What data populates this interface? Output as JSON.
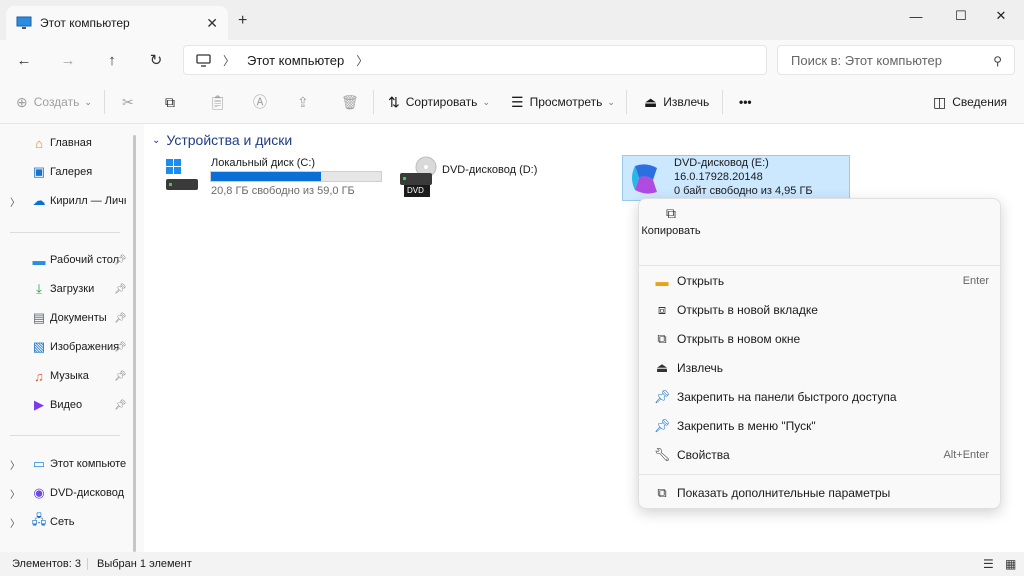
{
  "window": {
    "tab_title": "Этот компьютер",
    "tab_close": "✕",
    "new_tab": "+",
    "minimize": "—",
    "maximize": "☐",
    "close": "✕"
  },
  "nav": {
    "back": "←",
    "forward": "→",
    "up": "↑",
    "refresh": "↻",
    "breadcrumb": [
      "Этот компьютер"
    ],
    "search_placeholder": "Поиск в: Этот компьютер"
  },
  "toolbar": {
    "create": "Создать",
    "sort": "Сортировать",
    "view": "Просмотреть",
    "eject": "Извлечь",
    "more": "•••",
    "details": "Сведения"
  },
  "sidebar": {
    "items": [
      {
        "label": "Главная",
        "icon": "home-icon"
      },
      {
        "label": "Галерея",
        "icon": "gallery-icon"
      },
      {
        "label": "Кирилл — Личный",
        "icon": "onedrive-icon"
      },
      {
        "label": "Рабочий стол",
        "icon": "desktop-icon"
      },
      {
        "label": "Загрузки",
        "icon": "download-icon"
      },
      {
        "label": "Документы",
        "icon": "documents-icon"
      },
      {
        "label": "Изображения",
        "icon": "pictures-icon"
      },
      {
        "label": "Музыка",
        "icon": "music-icon"
      },
      {
        "label": "Видео",
        "icon": "video-icon"
      },
      {
        "label": "Этот компьютер",
        "icon": "pc-icon"
      },
      {
        "label": "DVD-дисковод (E:)",
        "icon": "dvd-icon"
      },
      {
        "label": "Сеть",
        "icon": "network-icon"
      }
    ]
  },
  "main": {
    "group_title": "Устройства и диски",
    "drives": [
      {
        "name": "Локальный диск (C:)",
        "free": "20,8 ГБ свободно из 59,0 ГБ",
        "used_fraction": 0.647
      },
      {
        "name": "DVD-дисковод (D:)",
        "badge": "DVD"
      },
      {
        "name": "DVD-дисковод (E:)",
        "version": "16.0.17928.20148",
        "free": "0 байт свободно из 4,95 ГБ"
      }
    ]
  },
  "context_menu": {
    "copy": "Копировать",
    "items": [
      {
        "label": "Открыть",
        "key": "Enter",
        "icon": "folder-icon"
      },
      {
        "label": "Открыть в новой вкладке",
        "key": "",
        "icon": "new-tab-icon"
      },
      {
        "label": "Открыть в новом окне",
        "key": "",
        "icon": "new-window-icon"
      },
      {
        "label": "Извлечь",
        "key": "",
        "icon": "eject-icon"
      },
      {
        "label": "Закрепить на панели быстрого доступа",
        "key": "",
        "icon": "pin-icon"
      },
      {
        "label": "Закрепить в меню \"Пуск\"",
        "key": "",
        "icon": "pin-start-icon"
      },
      {
        "label": "Свойства",
        "key": "Alt+Enter",
        "icon": "wrench-icon"
      }
    ],
    "more_options": "Показать дополнительные параметры"
  },
  "status": {
    "items_count": "Элементов: 3",
    "selected": "Выбран 1 элемент"
  },
  "colors": {
    "accent": "#0a6fd6",
    "selection": "#cce8ff"
  }
}
